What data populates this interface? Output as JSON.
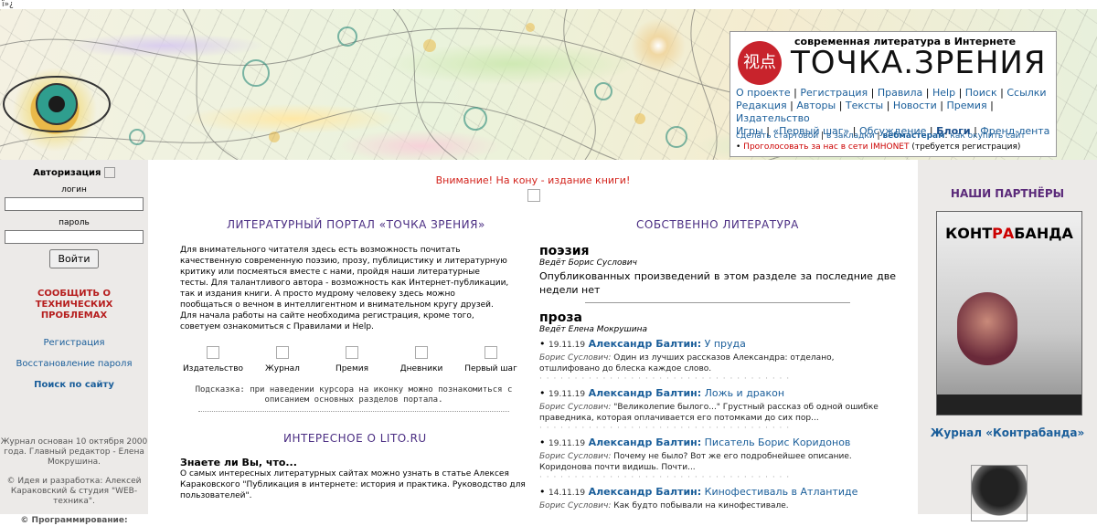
{
  "top_chars": "ï»¿",
  "header": {
    "tagline": "современная литература в Интернете",
    "logo": "ТОЧКА.ЗРЕНИЯ",
    "seal": "视点",
    "nav_lines": [
      [
        "О проекте",
        "Регистрация",
        "Правила",
        "Help",
        "Поиск",
        "Ссылки"
      ],
      [
        "Редакция",
        "Авторы",
        "Тексты",
        "Новости",
        "Премия",
        "Издательство"
      ],
      [
        "Игры",
        "«Первый шаг»",
        "Обсуждение",
        "Блоги",
        "Френд-лента"
      ]
    ],
    "bold_item": "Блоги",
    "links": {
      "start": "сделать стартовой",
      "bookmarks": "в закладки",
      "webmasters": "вебмастерам",
      "buy": "как окупить сайт",
      "vote": "Проголосовать за нас в сети IMHONET",
      "vote_note": "(требуется регистрация)"
    }
  },
  "left": {
    "auth_title": "Авторизация",
    "login_label": "логин",
    "password_label": "пароль",
    "login_button": "Войти",
    "report": "СООБЩИТЬ О ТЕХНИЧЕСКИХ ПРОБЛЕМАХ",
    "register": "Регистрация",
    "restore": "Восстановление пароля",
    "search": "Поиск по сайту",
    "founded": "Журнал основан 10 октября 2000 года. Главный редактор - Елена Мокрушина.",
    "idea": "© Идея и разработка: Алексей Караковский & студия \"WEB-техника\".",
    "programming": "© Программирование:"
  },
  "center": {
    "attention": "Внимание! На кону - издание книги!",
    "portal_title": "ЛИТЕРАТУРНЫЙ ПОРТАЛ «ТОЧКА ЗРЕНИЯ»",
    "intro": "Для внимательного читателя здесь есть возможность почитать качественную современную поэзию, прозу, публицистику и литературную критику или посмеяться вместе с нами, пройдя наши литературные тесты. Для талантливого автора - возможность как Интернет-публикации, так и издания книги. А просто мудрому человеку здесь можно пообщаться о вечном в интеллигентном и внимательном кругу друзей.",
    "intro2": "Для начала работы на сайте необходима регистрация, кроме того, советуем ознакомиться с Правилами и Help.",
    "icons": [
      "Издательство",
      "Журнал",
      "Премия",
      "Дневники",
      "Первый шаг"
    ],
    "hint": "Подсказка: при наведении курсора на иконку можно познакомиться с описанием основных разделов портала.",
    "interesting_title": "ИНТЕРЕСНОЕ О LITO.RU",
    "know_title": "Знаете ли Вы, что...",
    "know_text": "О самых интересных литературных сайтах можно узнать в статье Алексея Караковского \"Публикация в интернете: история и практика. Руководство для пользователей\"."
  },
  "literature": {
    "title": "СОБСТВЕННО ЛИТЕРАТУРА",
    "poetry": {
      "genre": "поэзия",
      "editor": "Ведёт Борис Суслович",
      "text": "Опубликованных произведений в этом разделе за последние две недели нет"
    },
    "prose": {
      "genre": "проза",
      "editor": "Ведёт Елена Мокрушина",
      "items": [
        {
          "date": "19.11.19",
          "author": "Александр Балтин:",
          "title": "У пруда",
          "who": "Борис Суслович:",
          "desc": "Один из лучших рассказов Александра: отделано, отшлифовано до блеска каждое слово."
        },
        {
          "date": "19.11.19",
          "author": "Александр Балтин:",
          "title": "Ложь и дракон",
          "who": "Борис Суслович:",
          "desc": "\"Великолепие былого...\" Грустный рассказ об одной ошибке праведника, которая оплачивается его потомками до сих пор..."
        },
        {
          "date": "19.11.19",
          "author": "Александр Балтин:",
          "title": "Писатель Борис Коридонов",
          "who": "Борис Суслович:",
          "desc": "Почему не было? Вот же его подробнейшее описание. Коридонова почти видишь. Почти..."
        },
        {
          "date": "14.11.19",
          "author": "Александр Балтин:",
          "title": "Кинофестиваль в Атлантиде",
          "who": "Борис Суслович:",
          "desc": "Как будто побывали на кинофестивале."
        }
      ]
    }
  },
  "right": {
    "partners_title": "НАШИ ПАРТНЁРЫ",
    "book_title_a": "КОНТ",
    "book_title_b": "РА",
    "book_title_c": "БАНДА",
    "journal": "Журнал «Контрабанда»"
  }
}
